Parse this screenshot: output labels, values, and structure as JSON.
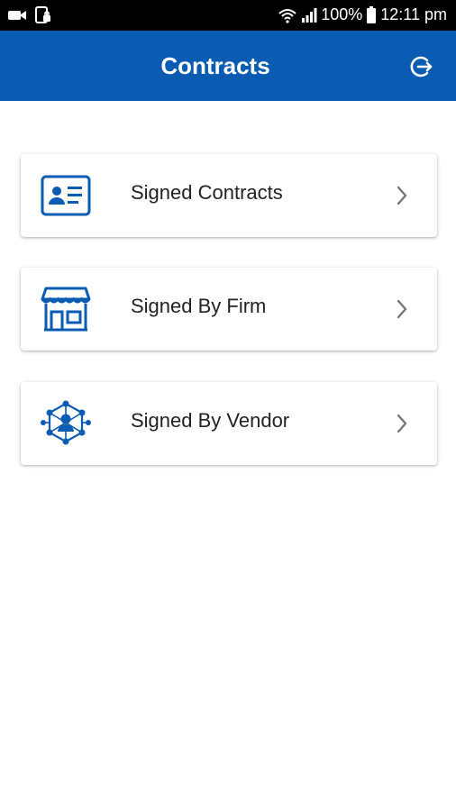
{
  "status_bar": {
    "battery": "100%",
    "time": "12:11 pm",
    "icons": [
      "video-camera-icon",
      "lock-screen-icon",
      "wifi-icon",
      "signal-icon",
      "battery-icon"
    ]
  },
  "header": {
    "title": "Contracts",
    "action_icon": "logout-icon"
  },
  "menu": {
    "items": [
      {
        "label": "Signed Contracts",
        "icon": "id-card-icon"
      },
      {
        "label": "Signed By Firm",
        "icon": "storefront-icon"
      },
      {
        "label": "Signed By Vendor",
        "icon": "vendor-network-icon"
      }
    ]
  },
  "colors": {
    "primary": "#0a5cb3",
    "status_bar": "#000000",
    "background": "#ffffff"
  }
}
